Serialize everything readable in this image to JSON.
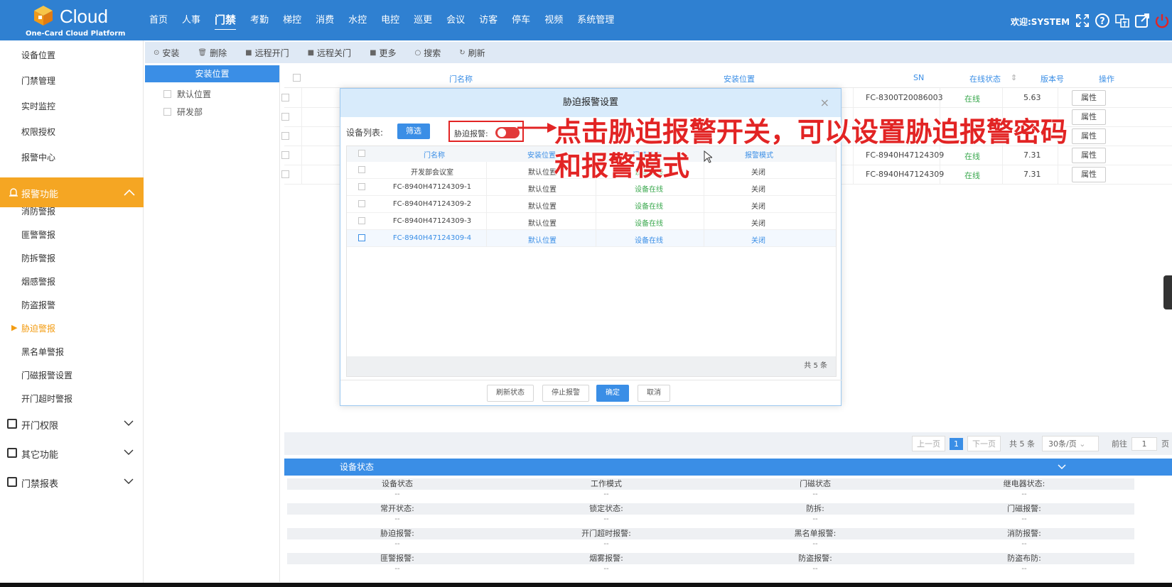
{
  "header": {
    "logo_text": "Cloud",
    "logo_subtitle": "One-Card Cloud Platform",
    "nav": [
      "首页",
      "人事",
      "门禁",
      "考勤",
      "梯控",
      "消费",
      "水控",
      "电控",
      "巡更",
      "会议",
      "访客",
      "停车",
      "视频",
      "系统管理"
    ],
    "active_nav": "门禁",
    "welcome": "欢迎:SYSTEM"
  },
  "sidebar": {
    "top_items": [
      "设备位置",
      "门禁管理",
      "实时监控",
      "权限授权",
      "报警中心"
    ],
    "expanded_group": "报警功能",
    "sub_items": [
      "消防警报",
      "匪警警报",
      "防拆警报",
      "烟感警报",
      "防盗报警",
      "胁迫警报",
      "黑名单警报",
      "门磁报警设置",
      "开门超时警报"
    ],
    "current_item": "胁迫警报",
    "collapsed_groups": [
      "开门权限",
      "其它功能",
      "门禁报表"
    ]
  },
  "toolbar": [
    "安装",
    "删除",
    "远程开门",
    "远程关门",
    "更多",
    "搜索",
    "刷新"
  ],
  "tree": {
    "header": "安装位置",
    "nodes": [
      "默认位置",
      "研发部"
    ]
  },
  "table": {
    "columns": [
      "门名称",
      "安装位置",
      "SN",
      "在线状态",
      "版本号",
      "操作"
    ],
    "rows": [
      {
        "sn": "FC-8300T20086003",
        "status": "在线",
        "version": "5.63",
        "action": "属性"
      },
      {
        "sn": "",
        "status": "",
        "version": "",
        "action": "属性"
      },
      {
        "sn": "",
        "status": "",
        "version": "",
        "action": "属性"
      },
      {
        "sn": "FC-8940H47124309",
        "status": "在线",
        "version": "7.31",
        "action": "属性"
      },
      {
        "sn": "FC-8940H47124309",
        "status": "在线",
        "version": "7.31",
        "action": "属性"
      }
    ]
  },
  "pager": {
    "prev": "上一页",
    "current": "1",
    "next": "下一页",
    "total": "共 5 条",
    "page_size": "30条/页",
    "goto_label": "前往",
    "goto_value": "1",
    "page_suffix": "页"
  },
  "status_panel": {
    "title": "设备状态",
    "rows": [
      [
        "设备状态",
        "工作模式",
        "门磁状态",
        "继电器状态:"
      ],
      [
        "常开状态:",
        "锁定状态:",
        "防拆:",
        "门磁报警:"
      ],
      [
        "胁迫报警:",
        "开门超时报警:",
        "黑名单报警:",
        "消防报警:"
      ],
      [
        "匪警报警:",
        "烟雾报警:",
        "防盗报警:",
        "防盗布防:"
      ]
    ],
    "empty_value": "--"
  },
  "modal": {
    "title": "胁迫报警设置",
    "device_list_label": "设备列表:",
    "filter_button": "筛选",
    "duress_label": "胁迫报警:",
    "duress_on": true,
    "columns": [
      "门名称",
      "安装位置",
      "门禁状态",
      "报警模式"
    ],
    "rows": [
      {
        "name": "开发部会议室",
        "location": "默认位置",
        "status": "设备在线",
        "mode": "关闭"
      },
      {
        "name": "FC-8940H47124309-1",
        "location": "默认位置",
        "status": "设备在线",
        "mode": "关闭"
      },
      {
        "name": "FC-8940H47124309-2",
        "location": "默认位置",
        "status": "设备在线",
        "mode": "关闭"
      },
      {
        "name": "FC-8940H47124309-3",
        "location": "默认位置",
        "status": "设备在线",
        "mode": "关闭"
      },
      {
        "name": "FC-8940H47124309-4",
        "location": "默认位置",
        "status": "设备在线",
        "mode": "关闭"
      }
    ],
    "total": "共 5 条",
    "buttons": [
      "刷新状态",
      "停止报警",
      "确定",
      "取消"
    ]
  },
  "annotation": {
    "line1": "点击胁迫报警开关，可以设置胁迫报警密码",
    "line2": "和报警模式"
  },
  "colors": {
    "header": "#2f80d1",
    "accent": "#3a8ee6",
    "sidebar_active": "#f5a623",
    "annotation": "#e22424",
    "online": "#3aa84e"
  }
}
